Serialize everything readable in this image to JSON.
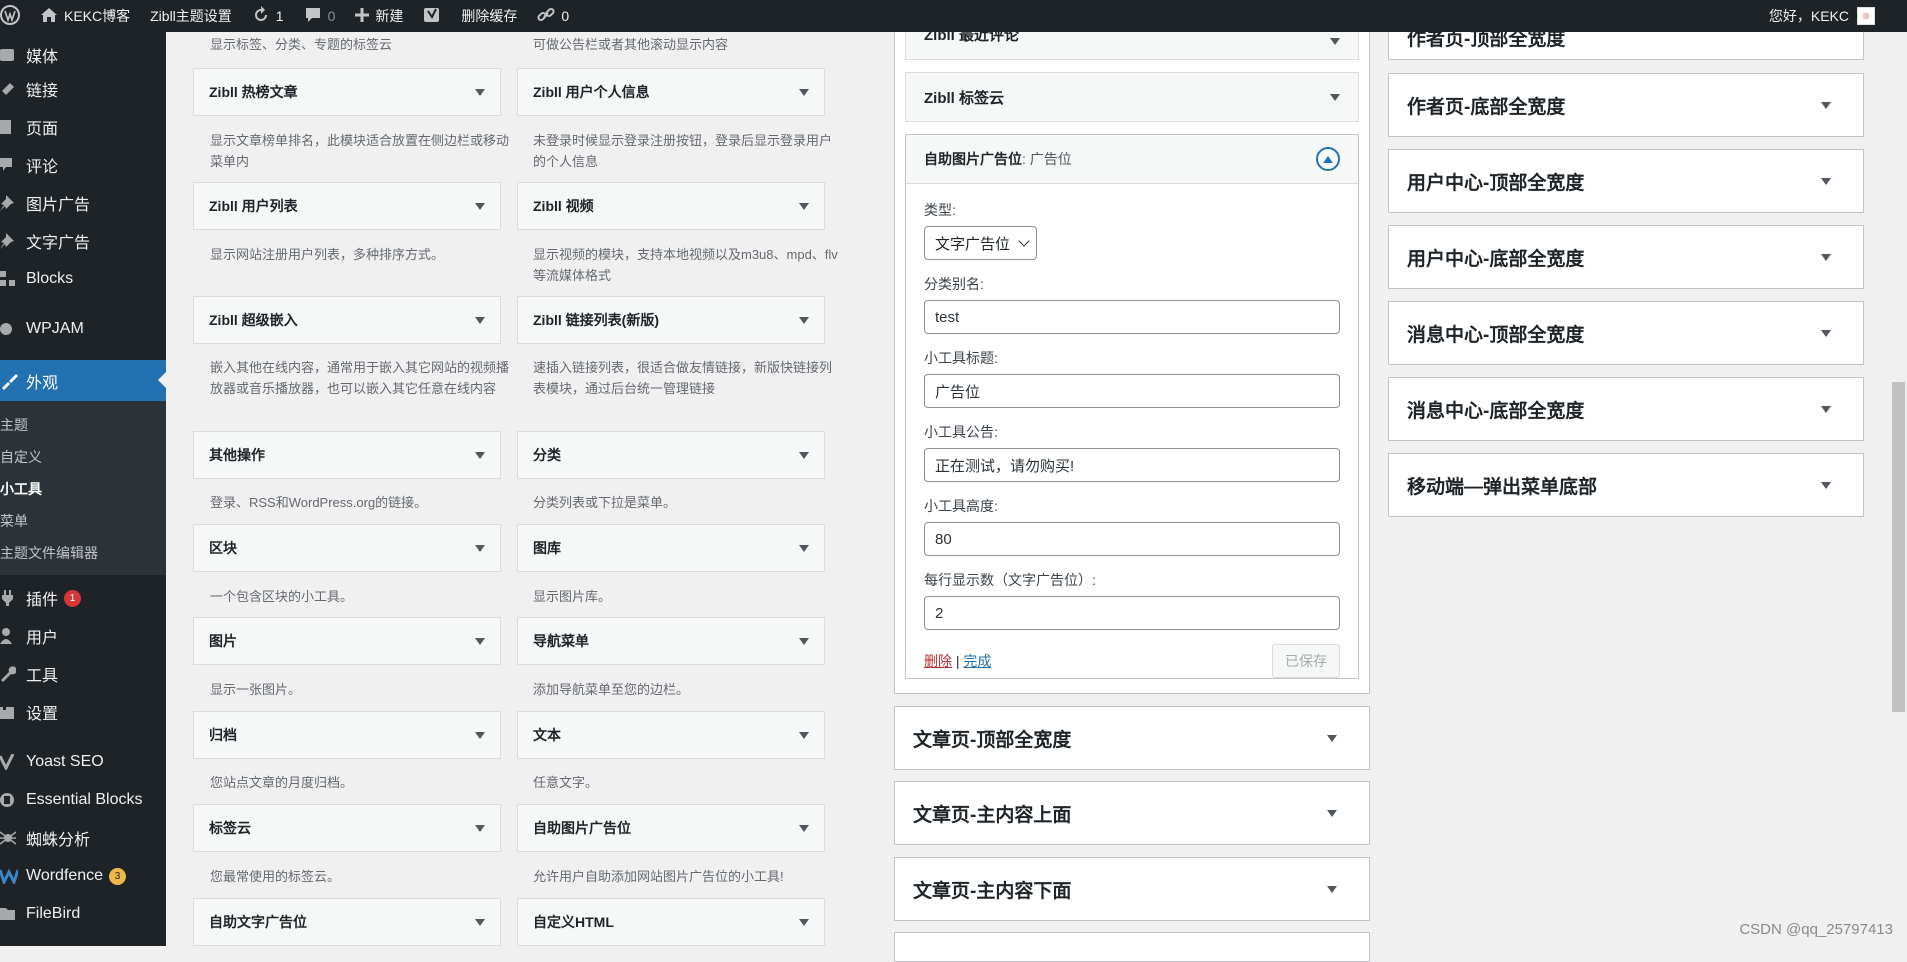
{
  "adminbar": {
    "site_name": "KEKC博客",
    "theme_settings": "Zibll主题设置",
    "updates_count": "1",
    "comments_count": "0",
    "new_label": "新建",
    "clear_cache": "删除缓存",
    "links_count": "0",
    "greeting": "您好，KEKC"
  },
  "sidemenu": {
    "items_top": [
      "媒体",
      "链接",
      "页面",
      "评论",
      "图片广告",
      "文字广告",
      "Blocks"
    ],
    "wpjam": "WPJAM",
    "appearance": "外观",
    "submenu": [
      "主题",
      "自定义",
      "小工具",
      "菜单",
      "主题文件编辑器"
    ],
    "plugins": "插件",
    "plugins_badge": "1",
    "users": "用户",
    "tools": "工具",
    "settings": "设置",
    "yoast": "Yoast SEO",
    "essential": "Essential Blocks",
    "spider": "蜘蛛分析",
    "wordfence": "Wordfence",
    "wordfence_badge": "3",
    "filebird": "FileBird"
  },
  "widgets": {
    "top_desc_left": "显示标签、分类、专题的标签云",
    "top_desc_right": "可做公告栏或者其他滚动显示内容",
    "items": [
      {
        "left": "Zibll 热榜文章",
        "left_desc": "显示文章榜单排名，此模块适合放置在侧边栏或移动菜单内",
        "right": "Zibll 用户个人信息",
        "right_desc": "未登录时候显示登录注册按钮，登录后显示登录用户的个人信息"
      },
      {
        "left": "Zibll 用户列表",
        "left_desc": "显示网站注册用户列表，多种排序方式。",
        "right": "Zibll 视频",
        "right_desc": "显示视频的模块，支持本地视频以及m3u8、mpd、flv等流媒体格式"
      },
      {
        "left": "Zibll 超级嵌入",
        "left_desc": "嵌入其他在线内容，通常用于嵌入其它网站的视频播放器或音乐播放器，也可以嵌入其它任意在线内容",
        "right": "Zibll 链接列表(新版)",
        "right_desc": "速插入链接列表，很适合做友情链接，新版快链接列表模块，通过后台统一管理链接"
      },
      {
        "left": "其他操作",
        "left_desc": "登录、RSS和WordPress.org的链接。",
        "right": "分类",
        "right_desc": "分类列表或下拉是菜单。"
      },
      {
        "left": "区块",
        "left_desc": "一个包含区块的小工具。",
        "right": "图库",
        "right_desc": "显示图片库。"
      },
      {
        "left": "图片",
        "left_desc": "显示一张图片。",
        "right": "导航菜单",
        "right_desc": "添加导航菜单至您的边栏。"
      },
      {
        "left": "归档",
        "left_desc": "您站点文章的月度归档。",
        "right": "文本",
        "right_desc": "任意文字。"
      },
      {
        "left": "标签云",
        "left_desc": "您最常使用的标签云。",
        "right": "自助图片广告位",
        "right_desc": "允许用户自助添加网站图片广告位的小工具!"
      },
      {
        "left": "自助文字广告位",
        "left_desc": "",
        "right": "自定义HTML",
        "right_desc": ""
      }
    ]
  },
  "middle": {
    "partial_top": "Zibll 最近评论",
    "tag_cloud": "Zibll 标签云",
    "form": {
      "title": "自助图片广告位",
      "in_title": ": 广告位",
      "type_label": "类型:",
      "type_value": "文字广告位",
      "alias_label": "分类别名:",
      "alias_value": "test",
      "title_label": "小工具标题:",
      "title_value": "广告位",
      "notice_label": "小工具公告:",
      "notice_value": "正在测试，请勿购买!",
      "height_label": "小工具高度:",
      "height_value": "80",
      "per_row_label": "每行显示数（文字广告位）:",
      "per_row_value": "2",
      "delete": "删除",
      "sep": " | ",
      "done": "完成",
      "saved": "已保存"
    },
    "areas": [
      "文章页-顶部全宽度",
      "文章页-主内容上面",
      "文章页-主内容下面"
    ]
  },
  "right": {
    "partial_top": "作者页-顶部全宽度",
    "areas": [
      "作者页-底部全宽度",
      "用户中心-顶部全宽度",
      "用户中心-底部全宽度",
      "消息中心-顶部全宽度",
      "消息中心-底部全宽度",
      "移动端—弹出菜单底部"
    ]
  },
  "watermark": "CSDN @qq_25797413"
}
